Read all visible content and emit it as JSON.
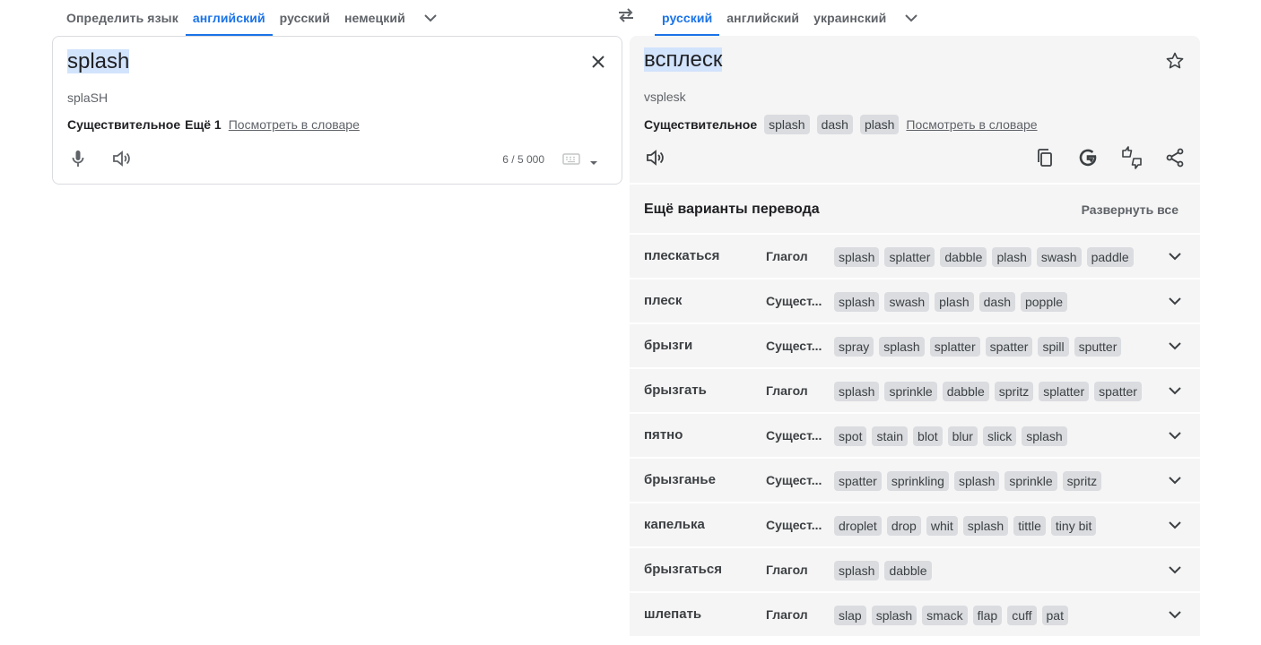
{
  "source_tabs": [
    {
      "label": "Определить язык",
      "active": false
    },
    {
      "label": "английский",
      "active": true
    },
    {
      "label": "русский",
      "active": false
    },
    {
      "label": "немецкий",
      "active": false
    }
  ],
  "target_tabs": [
    {
      "label": "русский",
      "active": true
    },
    {
      "label": "английский",
      "active": false
    },
    {
      "label": "украинский",
      "active": false
    }
  ],
  "source": {
    "text": "splash",
    "transliteration": "splaSH",
    "part_of_speech": "Существительное",
    "more": "Ещё 1",
    "dictionary_link": "Посмотреть в словаре",
    "char_count": "6 / 5 000"
  },
  "target": {
    "text": "всплеск",
    "transliteration": "vsplesk",
    "part_of_speech": "Существительное",
    "chips": [
      "splash",
      "dash",
      "plash"
    ],
    "dictionary_link": "Посмотреть в словаре"
  },
  "alternatives": {
    "title": "Ещё варианты перевода",
    "expand_all": "Развернуть все",
    "rows": [
      {
        "word": "плескаться",
        "pos": "Глагол",
        "chips": [
          "splash",
          "splatter",
          "dabble",
          "plash",
          "swash",
          "paddle"
        ]
      },
      {
        "word": "плеск",
        "pos": "Сущест...",
        "chips": [
          "splash",
          "swash",
          "plash",
          "dash",
          "popple"
        ]
      },
      {
        "word": "брызги",
        "pos": "Сущест...",
        "chips": [
          "spray",
          "splash",
          "splatter",
          "spatter",
          "spill",
          "sputter"
        ]
      },
      {
        "word": "брызгать",
        "pos": "Глагол",
        "chips": [
          "splash",
          "sprinkle",
          "dabble",
          "spritz",
          "splatter",
          "spatter"
        ]
      },
      {
        "word": "пятно",
        "pos": "Сущест...",
        "chips": [
          "spot",
          "stain",
          "blot",
          "blur",
          "slick",
          "splash"
        ]
      },
      {
        "word": "брызганье",
        "pos": "Сущест...",
        "chips": [
          "spatter",
          "sprinkling",
          "splash",
          "sprinkle",
          "spritz"
        ]
      },
      {
        "word": "капелька",
        "pos": "Сущест...",
        "chips": [
          "droplet",
          "drop",
          "whit",
          "splash",
          "tittle",
          "tiny bit"
        ]
      },
      {
        "word": "брызгаться",
        "pos": "Глагол",
        "chips": [
          "splash",
          "dabble"
        ]
      },
      {
        "word": "шлепать",
        "pos": "Глагол",
        "chips": [
          "slap",
          "splash",
          "smack",
          "flap",
          "cuff",
          "pat"
        ]
      }
    ]
  },
  "icons": {
    "swap": "swap-languages-icon",
    "close": "close-icon",
    "mic": "microphone-icon",
    "speaker": "speaker-icon",
    "keyboard": "keyboard-icon",
    "star": "star-icon",
    "copy": "copy-icon",
    "google": "google-icon",
    "feedback": "rate-translation-icon",
    "share": "share-icon",
    "chevron": "chevron-down-icon"
  },
  "colors": {
    "accent": "#1a73e8",
    "panel_bg": "#f5f5f5",
    "chip_bg": "#dadce0"
  }
}
